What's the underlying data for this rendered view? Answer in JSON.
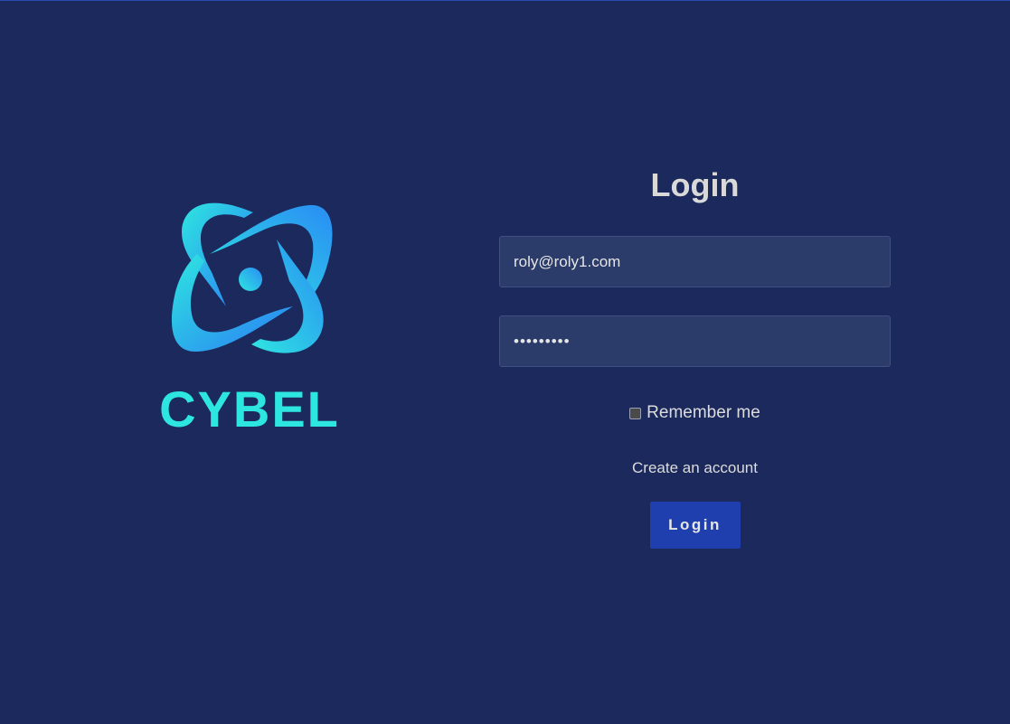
{
  "brand": {
    "name": "CYBEL",
    "colors": {
      "gradient_start": "#2ee6e0",
      "gradient_end": "#2a7cf5",
      "wordmark": "#2ee6e0"
    }
  },
  "login": {
    "title": "Login",
    "email_value": "roly@roly1.com",
    "password_value": "•••••••••",
    "remember_label": "Remember me",
    "remember_checked": false,
    "create_account_label": "Create an account",
    "submit_label": "Login"
  },
  "colors": {
    "background": "#1b295c",
    "input_bg": "#2b3b6a",
    "button_bg": "#1f3fae",
    "text": "#d9d9d9"
  }
}
